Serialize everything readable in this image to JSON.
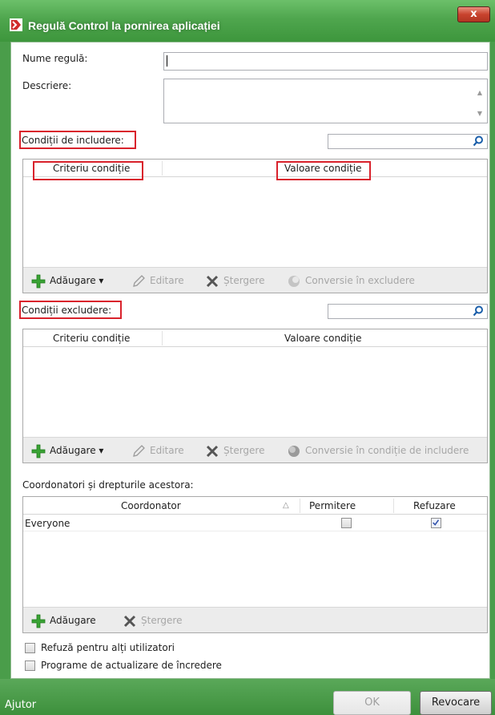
{
  "window": {
    "title": "Regulă Control la pornirea aplicației",
    "close_glyph": "x"
  },
  "form": {
    "rule_name_label": "Nume regulă:",
    "rule_name_value": "",
    "description_label": "Descriere:",
    "description_value": ""
  },
  "inclusion": {
    "label": "Condiții de includere:",
    "search_value": "",
    "columns": [
      "Criteriu condiție",
      "Valoare condiție"
    ],
    "toolbar": {
      "add": "Adăugare",
      "edit": "Editare",
      "delete": "Ștergere",
      "convert": "Conversie în excludere"
    }
  },
  "exclusion": {
    "label": "Condiții excludere:",
    "search_value": "",
    "columns": [
      "Criteriu condiție",
      "Valoare condiție"
    ],
    "toolbar": {
      "add": "Adăugare",
      "edit": "Editare",
      "delete": "Ștergere",
      "convert": "Conversie în condiție de includere"
    }
  },
  "owners": {
    "label": "Coordonatori și drepturile acestora:",
    "columns": [
      "Coordonator",
      "Permitere",
      "Refuzare"
    ],
    "sort_glyph": "△",
    "rows": [
      {
        "name": "Everyone",
        "allow": false,
        "deny": true
      }
    ],
    "toolbar": {
      "add": "Adăugare",
      "delete": "Ștergere"
    }
  },
  "options": {
    "deny_other_users": "Refuză pentru alți utilizatori",
    "trusted_updaters": "Programe de actualizare de încredere"
  },
  "footer": {
    "help": "Ajutor",
    "ok": "OK",
    "cancel": "Revocare"
  },
  "colors": {
    "titlebar_green": "#4fa64e",
    "highlight_red": "#d9222c",
    "add_green": "#3aa335"
  }
}
